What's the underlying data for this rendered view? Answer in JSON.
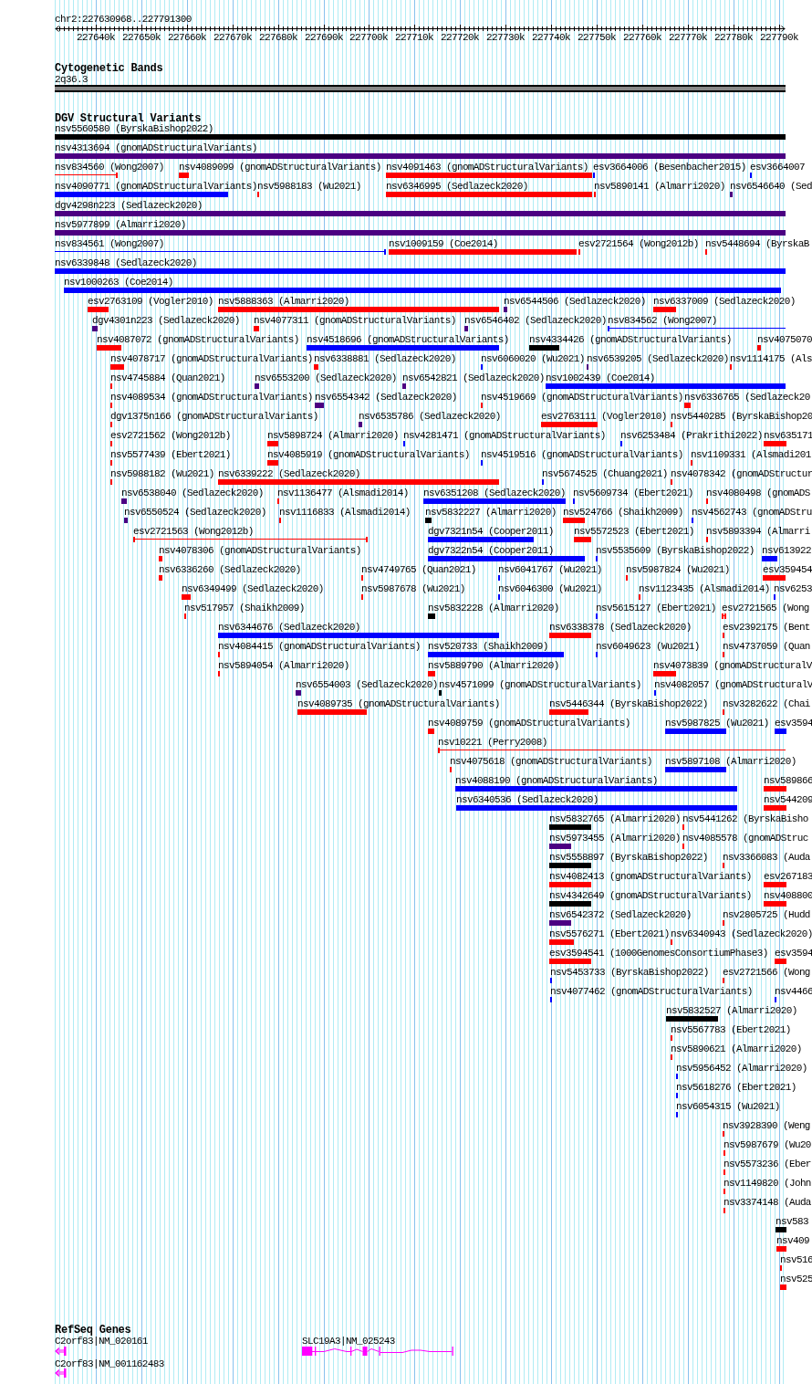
{
  "position": "chr2:227630968..227791300",
  "ruler": {
    "ticks": [
      "227640k",
      "227650k",
      "227660k",
      "227670k",
      "227680k",
      "227690k",
      "227700k",
      "227710k",
      "227720k",
      "227730k",
      "227740k",
      "227750k",
      "227760k",
      "227770k",
      "227780k",
      "227790k"
    ]
  },
  "tracks": [
    {
      "kind": "cytobands",
      "title": "Cytogenetic Bands",
      "bands": [
        {
          "label": "2q36.3"
        }
      ]
    },
    {
      "kind": "variants",
      "title": "DGV Structural Variants",
      "rows": [
        [
          {
            "label": "nsv5560580 (ByrskaBishop2022)",
            "color": "#000000"
          }
        ],
        [
          {
            "label": "nsv4313694 (gnomADStructuralVariants)",
            "color": "#4b0082"
          }
        ],
        [
          {
            "label": "nsv834560 (Wong2007)",
            "color": "#ff0000"
          },
          {
            "label": "nsv4089099 (gnomADStructuralVariants)",
            "color": "#ff0000"
          },
          {
            "label": "nsv4091463 (gnomADStructuralVariants)",
            "color": "#ff0000"
          },
          {
            "label": "esv3664006 (Besenbacher2015)",
            "color": "#0000ff"
          },
          {
            "label": "esv3664007",
            "color": "#0000ff"
          }
        ],
        [
          {
            "label": "nsv4090771 (gnomADStructuralVariants)",
            "color": "#0000ff"
          },
          {
            "label": "nsv5988183 (Wu2021)",
            "color": "#ff0000"
          },
          {
            "label": "nsv6346995 (Sedlazeck2020)",
            "color": "#ff0000"
          },
          {
            "label": "nsv5890141 (Almarri2020)",
            "color": "#ff0000"
          },
          {
            "label": "nsv6546640 (Sed",
            "color": "#4b0082"
          }
        ],
        [
          {
            "label": "dgv4298n223 (Sedlazeck2020)",
            "color": "#4b0082"
          }
        ],
        [
          {
            "label": "nsv5977899 (Almarri2020)",
            "color": "#4b0082"
          }
        ],
        [
          {
            "label": "nsv834561 (Wong2007)",
            "color": "#0000ff"
          },
          {
            "label": "nsv1009159 (Coe2014)",
            "color": "#ff0000"
          },
          {
            "label": "esv2721564 (Wong2012b)",
            "color": "#ff0000"
          },
          {
            "label": "nsv5448694 (ByrskaB",
            "color": "#ff0000"
          }
        ],
        [
          {
            "label": "nsv6339848 (Sedlazeck2020)",
            "color": "#0000ff"
          }
        ],
        [
          {
            "label": "nsv1000263 (Coe2014)",
            "color": "#0000ff"
          }
        ],
        [
          {
            "label": "esv2763109 (Vogler2010)",
            "color": "#ff0000"
          },
          {
            "label": "nsv5888363 (Almarri2020)",
            "color": "#ff0000"
          },
          {
            "label": "nsv6544506 (Sedlazeck2020)",
            "color": "#4b0082"
          },
          {
            "label": "nsv6337009 (Sedlazeck2020)",
            "color": "#ff0000"
          }
        ],
        [
          {
            "label": "dgv4301n223 (Sedlazeck2020)",
            "color": "#4b0082"
          },
          {
            "label": "nsv4077311 (gnomADStructuralVariants)",
            "color": "#ff0000"
          },
          {
            "label": "nsv6546402 (Sedlazeck2020)",
            "color": "#4b0082"
          },
          {
            "label": "nsv834562 (Wong2007)",
            "color": "#0000ff"
          }
        ],
        [
          {
            "label": "nsv4087072 (gnomADStructuralVariants)",
            "color": "#ff0000"
          },
          {
            "label": "nsv4518696 (gnomADStructuralVariants)",
            "color": "#0000ff"
          },
          {
            "label": "nsv4334426 (gnomADStructuralVariants)",
            "color": "#000000"
          },
          {
            "label": "nsv4075070",
            "color": "#ff0000"
          }
        ],
        [
          {
            "label": "nsv4078717 (gnomADStructuralVariants)",
            "color": "#ff0000"
          },
          {
            "label": "nsv6338881 (Sedlazeck2020)",
            "color": "#ff0000"
          },
          {
            "label": "nsv6060020 (Wu2021)",
            "color": "#0000ff"
          },
          {
            "label": "nsv6539205 (Sedlazeck2020)",
            "color": "#4b0082"
          },
          {
            "label": "nsv1114175 (Als",
            "color": "#ff0000"
          }
        ],
        [
          {
            "label": "nsv4745884 (Quan2021)",
            "color": "#ff0000"
          },
          {
            "label": "nsv6553200 (Sedlazeck2020)",
            "color": "#4b0082"
          },
          {
            "label": "nsv6542821 (Sedlazeck2020)",
            "color": "#4b0082"
          },
          {
            "label": "nsv1002439 (Coe2014)",
            "color": "#0000ff"
          }
        ],
        [
          {
            "label": "nsv4089534 (gnomADStructuralVariants)",
            "color": "#ff0000"
          },
          {
            "label": "nsv6554342 (Sedlazeck2020)",
            "color": "#4b0082"
          },
          {
            "label": "nsv4519669 (gnomADStructuralVariants)",
            "color": "#ff0000"
          },
          {
            "label": "nsv6336765 (Sedlazeck20",
            "color": "#ff0000"
          }
        ],
        [
          {
            "label": "dgv1375n166 (gnomADStructuralVariants)",
            "color": "#ff0000"
          },
          {
            "label": "nsv6535786 (Sedlazeck2020)",
            "color": "#4b0082"
          },
          {
            "label": "esv2763111 (Vogler2010)",
            "color": "#ff0000"
          },
          {
            "label": "nsv5440285 (ByrskaBishop20",
            "color": "#ff0000"
          }
        ],
        [
          {
            "label": "esv2721562 (Wong2012b)",
            "color": "#ff0000"
          },
          {
            "label": "nsv5898724 (Almarri2020)",
            "color": "#ff0000"
          },
          {
            "label": "nsv4281471 (gnomADStructuralVariants)",
            "color": "#0000ff"
          },
          {
            "label": "nsv6253484 (Prakrithi2022)",
            "color": "#0000ff"
          },
          {
            "label": "nsv635171",
            "color": "#ff0000"
          }
        ],
        [
          {
            "label": "nsv5577439 (Ebert2021)",
            "color": "#ff0000"
          },
          {
            "label": "nsv4085919 (gnomADStructuralVariants)",
            "color": "#ff0000"
          },
          {
            "label": "nsv4519516 (gnomADStructuralVariants)",
            "color": "#0000ff"
          },
          {
            "label": "nsv1109331 (Alsmadi201",
            "color": "#ff0000"
          }
        ],
        [
          {
            "label": "nsv5988182 (Wu2021)",
            "color": "#ff0000"
          },
          {
            "label": "nsv6339222 (Sedlazeck2020)",
            "color": "#ff0000"
          },
          {
            "label": "nsv5674525 (Chuang2021)",
            "color": "#0000ff"
          },
          {
            "label": "nsv4078342 (gnomADStructur",
            "color": "#ff0000"
          }
        ],
        [
          {
            "label": "nsv6538040 (Sedlazeck2020)",
            "color": "#4b0082"
          },
          {
            "label": "nsv1136477 (Alsmadi2014)",
            "color": "#ff0000"
          },
          {
            "label": "nsv6351208 (Sedlazeck2020)",
            "color": "#0000ff"
          },
          {
            "label": "nsv5609734 (Ebert2021)",
            "color": "#0000ff"
          },
          {
            "label": "nsv4080498 (gnomADS",
            "color": "#ff0000"
          }
        ],
        [
          {
            "label": "nsv6550524 (Sedlazeck2020)",
            "color": "#4b0082"
          },
          {
            "label": "nsv1116833 (Alsmadi2014)",
            "color": "#ff0000"
          },
          {
            "label": "nsv5832227 (Almarri2020)",
            "color": "#000000"
          },
          {
            "label": "nsv524766 (Shaikh2009)",
            "color": "#ff0000"
          },
          {
            "label": "nsv4562743 (gnomADStru",
            "color": "#0000ff"
          }
        ],
        [
          {
            "label": "esv2721563 (Wong2012b)",
            "color": "#ff0000"
          },
          {
            "label": "dgv7321n54 (Cooper2011)",
            "color": "#0000ff"
          },
          {
            "label": "nsv5572523 (Ebert2021)",
            "color": "#ff0000"
          },
          {
            "label": "nsv5893394 (Almarri",
            "color": "#ff0000"
          }
        ],
        [
          {
            "label": "nsv4078306 (gnomADStructuralVariants)",
            "color": "#ff0000"
          },
          {
            "label": "dgv7322n54 (Cooper2011)",
            "color": "#0000ff"
          },
          {
            "label": "nsv5535609 (ByrskaBishop2022)",
            "color": "#0000ff"
          },
          {
            "label": "nsv613922",
            "color": "#0000ff"
          }
        ],
        [
          {
            "label": "nsv6336260 (Sedlazeck2020)",
            "color": "#ff0000"
          },
          {
            "label": "nsv4749765 (Quan2021)",
            "color": "#ff0000"
          },
          {
            "label": "nsv6041767 (Wu2021)",
            "color": "#0000ff"
          },
          {
            "label": "nsv5987824 (Wu2021)",
            "color": "#ff0000"
          },
          {
            "label": "esv359454",
            "color": "#ff0000"
          }
        ],
        [
          {
            "label": "nsv6349499 (Sedlazeck2020)",
            "color": "#ff0000"
          },
          {
            "label": "nsv5987678 (Wu2021)",
            "color": "#ff0000"
          },
          {
            "label": "nsv6046300 (Wu2021)",
            "color": "#0000ff"
          },
          {
            "label": "nsv1123435 (Alsmadi2014)",
            "color": "#ff0000"
          },
          {
            "label": "nsv6253",
            "color": "#0000ff"
          }
        ],
        [
          {
            "label": "nsv517957 (Shaikh2009)",
            "color": "#ff0000"
          },
          {
            "label": "nsv5832228 (Almarri2020)",
            "color": "#000000"
          },
          {
            "label": "nsv5615127 (Ebert2021)",
            "color": "#0000ff"
          },
          {
            "label": "esv2721565 (Wong",
            "color": "#ff0000"
          }
        ],
        [
          {
            "label": "nsv6344676 (Sedlazeck2020)",
            "color": "#0000ff"
          },
          {
            "label": "nsv6338378 (Sedlazeck2020)",
            "color": "#ff0000"
          },
          {
            "label": "esv2392175 (Bent",
            "color": "#ff0000"
          }
        ],
        [
          {
            "label": "nsv4084415 (gnomADStructuralVariants)",
            "color": "#ff0000"
          },
          {
            "label": "nsv520733 (Shaikh2009)",
            "color": "#0000ff"
          },
          {
            "label": "nsv6049623 (Wu2021)",
            "color": "#0000ff"
          },
          {
            "label": "nsv4737059 (Quan",
            "color": "#ff0000"
          }
        ],
        [
          {
            "label": "nsv5894054 (Almarri2020)",
            "color": "#ff0000"
          },
          {
            "label": "nsv5889790 (Almarri2020)",
            "color": "#ff0000"
          },
          {
            "label": "nsv4073839 (gnomADStructuralV",
            "color": "#ff0000"
          }
        ],
        [
          {
            "label": "nsv6554003 (Sedlazeck2020)",
            "color": "#4b0082"
          },
          {
            "label": "nsv4571099 (gnomADStructuralVariants)",
            "color": "#000000"
          },
          {
            "label": "nsv4082057 (gnomADStructuralV",
            "color": "#0000ff"
          }
        ],
        [
          {
            "label": "nsv4089735 (gnomADStructuralVariants)",
            "color": "#ff0000"
          },
          {
            "label": "nsv5446344 (ByrskaBishop2022)",
            "color": "#ff0000"
          },
          {
            "label": "nsv3282622 (Chai",
            "color": "#ff0000"
          }
        ],
        [
          {
            "label": "nsv4089759 (gnomADStructuralVariants)",
            "color": "#ff0000"
          },
          {
            "label": "nsv5987825 (Wu2021)",
            "color": "#0000ff"
          },
          {
            "label": "esv3594",
            "color": "#0000ff"
          }
        ],
        [
          {
            "label": "nsv10221 (Perry2008)",
            "color": "#ff0000"
          }
        ],
        [
          {
            "label": "nsv4075618 (gnomADStructuralVariants)",
            "color": "#ff0000"
          },
          {
            "label": "nsv5897108 (Almarri2020)",
            "color": "#0000ff"
          }
        ],
        [
          {
            "label": "nsv4088190 (gnomADStructuralVariants)",
            "color": "#0000ff"
          },
          {
            "label": "nsv589866",
            "color": "#ff0000"
          }
        ],
        [
          {
            "label": "nsv6340536 (Sedlazeck2020)",
            "color": "#0000ff"
          },
          {
            "label": "nsv544209",
            "color": "#ff0000"
          }
        ],
        [
          {
            "label": "nsv5832765 (Almarri2020)",
            "color": "#000000"
          },
          {
            "label": "nsv5441262 (ByrskaBisho",
            "color": "#ff0000"
          }
        ],
        [
          {
            "label": "nsv5973455 (Almarri2020)",
            "color": "#4b0082"
          },
          {
            "label": "nsv4085578 (gnomADStruc",
            "color": "#ff0000"
          }
        ],
        [
          {
            "label": "nsv5558897 (ByrskaBishop2022)",
            "color": "#000000"
          },
          {
            "label": "nsv3366083 (Auda",
            "color": "#ff0000"
          }
        ],
        [
          {
            "label": "nsv4082413 (gnomADStructuralVariants)",
            "color": "#ff0000"
          },
          {
            "label": "esv267183",
            "color": "#ff0000"
          }
        ],
        [
          {
            "label": "nsv4342649 (gnomADStructuralVariants)",
            "color": "#000000"
          },
          {
            "label": "nsv408800",
            "color": "#ff0000"
          }
        ],
        [
          {
            "label": "nsv6542372 (Sedlazeck2020)",
            "color": "#4b0082"
          },
          {
            "label": "nsv2805725 (Hudd",
            "color": "#ff0000"
          }
        ],
        [
          {
            "label": "nsv5576271 (Ebert2021)",
            "color": "#ff0000"
          },
          {
            "label": "nsv6340943 (Sedlazeck2020)",
            "color": "#ff0000"
          }
        ],
        [
          {
            "label": "esv3594541 (1000GenomesConsortiumPhase3)",
            "color": "#ff0000"
          },
          {
            "label": "esv3594",
            "color": "#ff0000"
          }
        ],
        [
          {
            "label": "nsv5453733 (ByrskaBishop2022)",
            "color": "#0000ff"
          },
          {
            "label": "esv2721566 (Wong",
            "color": "#ff0000"
          }
        ],
        [
          {
            "label": "nsv4077462 (gnomADStructuralVariants)",
            "color": "#0000ff"
          },
          {
            "label": "nsv4466",
            "color": "#0000ff"
          }
        ],
        [
          {
            "label": "nsv5832527 (Almarri2020)",
            "color": "#000000"
          }
        ],
        [
          {
            "label": "nsv5567783 (Ebert2021)",
            "color": "#ff0000"
          }
        ],
        [
          {
            "label": "nsv5890621 (Almarri2020)",
            "color": "#ff0000"
          }
        ],
        [
          {
            "label": "nsv5956452 (Almarri2020)",
            "color": "#0000ff"
          }
        ],
        [
          {
            "label": "nsv5618276 (Ebert2021)",
            "color": "#0000ff"
          }
        ],
        [
          {
            "label": "nsv6054315 (Wu2021)",
            "color": "#0000ff"
          }
        ],
        [
          {
            "label": "nsv3928390 (Weng",
            "color": "#ff0000"
          }
        ],
        [
          {
            "label": "nsv5987679 (Wu20",
            "color": "#ff0000"
          }
        ],
        [
          {
            "label": "nsv5573236 (Eber",
            "color": "#ff0000"
          }
        ],
        [
          {
            "label": "nsv1149820 (John",
            "color": "#ff0000"
          }
        ],
        [
          {
            "label": "nsv3374148 (Auda",
            "color": "#ff0000"
          }
        ],
        [
          {
            "label": "nsv583",
            "color": "#000000"
          }
        ],
        [
          {
            "label": "nsv409",
            "color": "#ff0000"
          }
        ],
        [
          {
            "label": "nsv516",
            "color": "#ff0000"
          }
        ],
        [
          {
            "label": "nsv525",
            "color": "#ff0000"
          }
        ]
      ]
    },
    {
      "kind": "genes",
      "title": "RefSeq Genes",
      "rows": [
        [
          {
            "label": "C2orf83|NM_020161"
          },
          {
            "label": "SLC19A3|NM_025243"
          }
        ],
        [
          {
            "label": "C2orf83|NM_001162483"
          }
        ]
      ]
    }
  ]
}
